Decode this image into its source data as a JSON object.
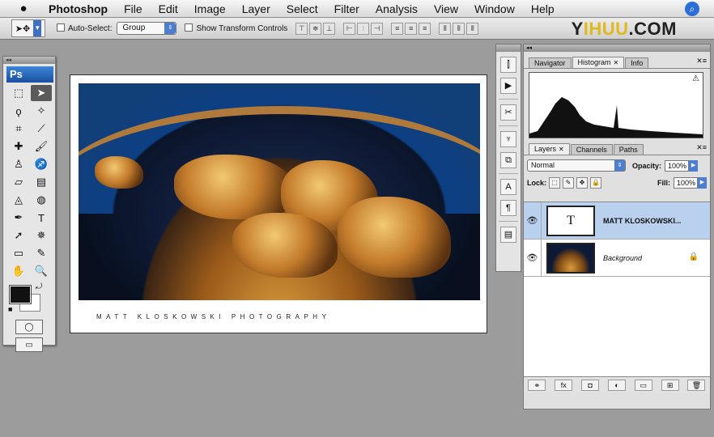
{
  "menubar": {
    "apple": "",
    "items": [
      "Photoshop",
      "File",
      "Edit",
      "Image",
      "Layer",
      "Select",
      "Filter",
      "Analysis",
      "View",
      "Window",
      "Help"
    ]
  },
  "options": {
    "auto_select": "Auto-Select:",
    "auto_select_target": "Group",
    "show_transform": "Show Transform Controls",
    "watermark_pre": "Y",
    "watermark_mid": "IHUU",
    "watermark_post": ".COM"
  },
  "tools": {
    "logo": "Ps"
  },
  "document": {
    "caption": "MATT KLOSKOWSKI PHOTOGRAPHY"
  },
  "navigator_group": {
    "tabs": [
      "Navigator",
      "Histogram",
      "Info"
    ],
    "active": "Histogram",
    "histogram_shape": "peak-left, tail-right"
  },
  "layers_group": {
    "tabs": [
      "Layers",
      "Channels",
      "Paths"
    ],
    "blend_mode": "Normal",
    "opacity_label": "Opacity:",
    "opacity_value": "100%",
    "lock_label": "Lock:",
    "fill_label": "Fill:",
    "fill_value": "100%",
    "layers": [
      {
        "name": "MATT KLOSKOWSKI...",
        "thumb": "T",
        "selected": true
      },
      {
        "name": "Background",
        "thumb": "",
        "selected": false
      }
    ]
  },
  "colors": {
    "accent": "#3d6fc4",
    "selection": "#b9d1ee"
  }
}
